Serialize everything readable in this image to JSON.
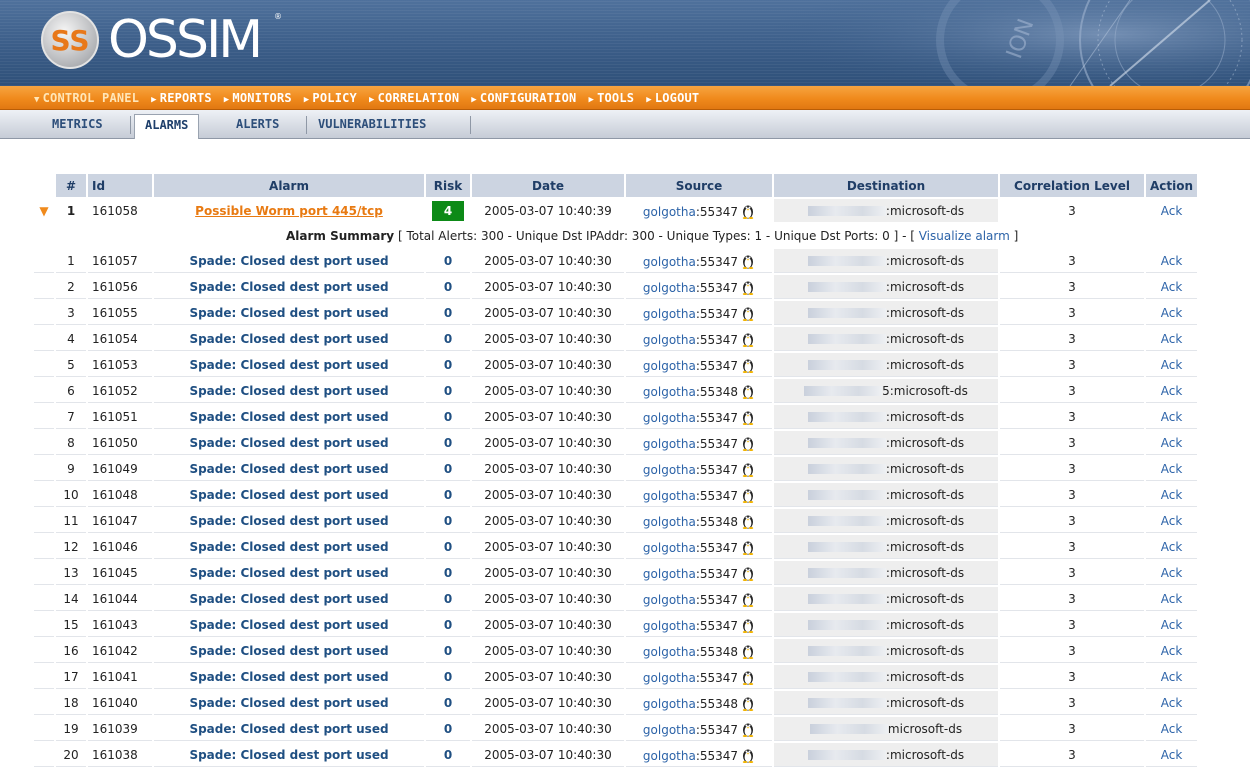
{
  "brand": {
    "name": "OSSIM",
    "logo_initials": "SS"
  },
  "main_menu": [
    {
      "label": "CONTROL PANEL",
      "active": true
    },
    {
      "label": "REPORTS"
    },
    {
      "label": "MONITORS"
    },
    {
      "label": "POLICY"
    },
    {
      "label": "CORRELATION"
    },
    {
      "label": "CONFIGURATION"
    },
    {
      "label": "TOOLS"
    },
    {
      "label": "LOGOUT"
    }
  ],
  "sub_menu": [
    {
      "label": "METRICS"
    },
    {
      "label": "ALARMS",
      "active": true
    },
    {
      "label": "ALERTS"
    },
    {
      "label": "VULNERABILITIES"
    }
  ],
  "table": {
    "headers": [
      "#",
      "Id",
      "Alarm",
      "Risk",
      "Date",
      "Source",
      "Destination",
      "Correlation Level",
      "Action"
    ],
    "main_row": {
      "num": "1",
      "id": "161058",
      "alarm": "Possible Worm port 445/tcp",
      "risk": "4",
      "date": "2005-03-07 10:40:39",
      "src_host": "golgotha",
      "src_port": ":55347",
      "dst_suffix": ":microsoft-ds",
      "corr": "3",
      "action": "Ack"
    },
    "summary": {
      "label": "Alarm Summary",
      "text": " [ Total Alerts: 300 - Unique Dst IPAddr: 300 - Unique Types: 1 - Unique Dst Ports: 0 ] - [ ",
      "link": "Visualize alarm",
      "end": " ]"
    },
    "rows": [
      {
        "num": "1",
        "id": "161057",
        "alarm": "Spade: Closed dest port used",
        "risk": "0",
        "date": "2005-03-07 10:40:30",
        "src_host": "golgotha",
        "src_port": ":55347",
        "dst_suffix": ":microsoft-ds",
        "corr": "3",
        "action": "Ack"
      },
      {
        "num": "2",
        "id": "161056",
        "alarm": "Spade: Closed dest port used",
        "risk": "0",
        "date": "2005-03-07 10:40:30",
        "src_host": "golgotha",
        "src_port": ":55347",
        "dst_suffix": ":microsoft-ds",
        "corr": "3",
        "action": "Ack"
      },
      {
        "num": "3",
        "id": "161055",
        "alarm": "Spade: Closed dest port used",
        "risk": "0",
        "date": "2005-03-07 10:40:30",
        "src_host": "golgotha",
        "src_port": ":55347",
        "dst_suffix": ":microsoft-ds",
        "corr": "3",
        "action": "Ack"
      },
      {
        "num": "4",
        "id": "161054",
        "alarm": "Spade: Closed dest port used",
        "risk": "0",
        "date": "2005-03-07 10:40:30",
        "src_host": "golgotha",
        "src_port": ":55347",
        "dst_suffix": ":microsoft-ds",
        "corr": "3",
        "action": "Ack"
      },
      {
        "num": "5",
        "id": "161053",
        "alarm": "Spade: Closed dest port used",
        "risk": "0",
        "date": "2005-03-07 10:40:30",
        "src_host": "golgotha",
        "src_port": ":55347",
        "dst_suffix": ":microsoft-ds",
        "corr": "3",
        "action": "Ack"
      },
      {
        "num": "6",
        "id": "161052",
        "alarm": "Spade: Closed dest port used",
        "risk": "0",
        "date": "2005-03-07 10:40:30",
        "src_host": "golgotha",
        "src_port": ":55348",
        "dst_suffix": "5:microsoft-ds",
        "corr": "3",
        "action": "Ack"
      },
      {
        "num": "7",
        "id": "161051",
        "alarm": "Spade: Closed dest port used",
        "risk": "0",
        "date": "2005-03-07 10:40:30",
        "src_host": "golgotha",
        "src_port": ":55347",
        "dst_suffix": ":microsoft-ds",
        "corr": "3",
        "action": "Ack"
      },
      {
        "num": "8",
        "id": "161050",
        "alarm": "Spade: Closed dest port used",
        "risk": "0",
        "date": "2005-03-07 10:40:30",
        "src_host": "golgotha",
        "src_port": ":55347",
        "dst_suffix": ":microsoft-ds",
        "corr": "3",
        "action": "Ack"
      },
      {
        "num": "9",
        "id": "161049",
        "alarm": "Spade: Closed dest port used",
        "risk": "0",
        "date": "2005-03-07 10:40:30",
        "src_host": "golgotha",
        "src_port": ":55347",
        "dst_suffix": ":microsoft-ds",
        "corr": "3",
        "action": "Ack"
      },
      {
        "num": "10",
        "id": "161048",
        "alarm": "Spade: Closed dest port used",
        "risk": "0",
        "date": "2005-03-07 10:40:30",
        "src_host": "golgotha",
        "src_port": ":55347",
        "dst_suffix": ":microsoft-ds",
        "corr": "3",
        "action": "Ack"
      },
      {
        "num": "11",
        "id": "161047",
        "alarm": "Spade: Closed dest port used",
        "risk": "0",
        "date": "2005-03-07 10:40:30",
        "src_host": "golgotha",
        "src_port": ":55348",
        "dst_suffix": ":microsoft-ds",
        "corr": "3",
        "action": "Ack"
      },
      {
        "num": "12",
        "id": "161046",
        "alarm": "Spade: Closed dest port used",
        "risk": "0",
        "date": "2005-03-07 10:40:30",
        "src_host": "golgotha",
        "src_port": ":55347",
        "dst_suffix": ":microsoft-ds",
        "corr": "3",
        "action": "Ack"
      },
      {
        "num": "13",
        "id": "161045",
        "alarm": "Spade: Closed dest port used",
        "risk": "0",
        "date": "2005-03-07 10:40:30",
        "src_host": "golgotha",
        "src_port": ":55347",
        "dst_suffix": ":microsoft-ds",
        "corr": "3",
        "action": "Ack"
      },
      {
        "num": "14",
        "id": "161044",
        "alarm": "Spade: Closed dest port used",
        "risk": "0",
        "date": "2005-03-07 10:40:30",
        "src_host": "golgotha",
        "src_port": ":55347",
        "dst_suffix": ":microsoft-ds",
        "corr": "3",
        "action": "Ack"
      },
      {
        "num": "15",
        "id": "161043",
        "alarm": "Spade: Closed dest port used",
        "risk": "0",
        "date": "2005-03-07 10:40:30",
        "src_host": "golgotha",
        "src_port": ":55347",
        "dst_suffix": ":microsoft-ds",
        "corr": "3",
        "action": "Ack"
      },
      {
        "num": "16",
        "id": "161042",
        "alarm": "Spade: Closed dest port used",
        "risk": "0",
        "date": "2005-03-07 10:40:30",
        "src_host": "golgotha",
        "src_port": ":55348",
        "dst_suffix": ":microsoft-ds",
        "corr": "3",
        "action": "Ack"
      },
      {
        "num": "17",
        "id": "161041",
        "alarm": "Spade: Closed dest port used",
        "risk": "0",
        "date": "2005-03-07 10:40:30",
        "src_host": "golgotha",
        "src_port": ":55347",
        "dst_suffix": ":microsoft-ds",
        "corr": "3",
        "action": "Ack"
      },
      {
        "num": "18",
        "id": "161040",
        "alarm": "Spade: Closed dest port used",
        "risk": "0",
        "date": "2005-03-07 10:40:30",
        "src_host": "golgotha",
        "src_port": ":55348",
        "dst_suffix": ":microsoft-ds",
        "corr": "3",
        "action": "Ack"
      },
      {
        "num": "19",
        "id": "161039",
        "alarm": "Spade: Closed dest port used",
        "risk": "0",
        "date": "2005-03-07 10:40:30",
        "src_host": "golgotha",
        "src_port": ":55347",
        "dst_suffix": "microsoft-ds",
        "corr": "3",
        "action": "Ack"
      },
      {
        "num": "20",
        "id": "161038",
        "alarm": "Spade: Closed dest port used",
        "risk": "0",
        "date": "2005-03-07 10:40:30",
        "src_host": "golgotha",
        "src_port": ":55347",
        "dst_suffix": ":microsoft-ds",
        "corr": "3",
        "action": "Ack"
      }
    ]
  },
  "colors": {
    "menu_orange": "#f08a1c",
    "header_blue": "#3b5d88",
    "risk_green": "#0d8a17",
    "link_blue": "#1f4f82"
  },
  "icons": {
    "source_os": "linux-penguin-icon",
    "expand": "expand-arrow-icon"
  }
}
